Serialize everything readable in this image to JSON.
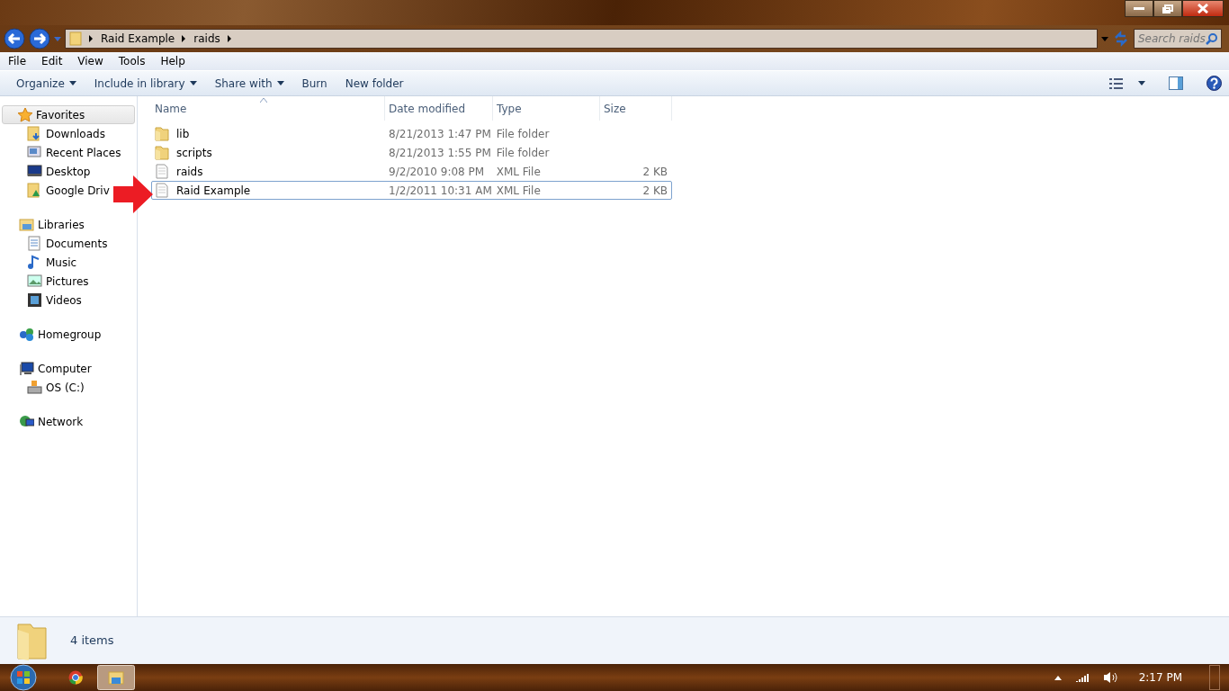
{
  "address_bar": {
    "crumbs": [
      "Raid Example",
      "raids"
    ]
  },
  "search": {
    "placeholder": "Search raids"
  },
  "menu": [
    "File",
    "Edit",
    "View",
    "Tools",
    "Help"
  ],
  "toolbar": [
    {
      "label": "Organize",
      "dropdown": true
    },
    {
      "label": "Include in library",
      "dropdown": true
    },
    {
      "label": "Share with",
      "dropdown": true
    },
    {
      "label": "Burn",
      "dropdown": false
    },
    {
      "label": "New folder",
      "dropdown": false
    }
  ],
  "sidebar": [
    {
      "label": "Favorites",
      "selected": true,
      "children": [
        {
          "label": "Downloads"
        },
        {
          "label": "Recent Places"
        },
        {
          "label": "Desktop"
        },
        {
          "label": "Google Driv"
        }
      ]
    },
    {
      "label": "Libraries",
      "selected": false,
      "children": [
        {
          "label": "Documents"
        },
        {
          "label": "Music"
        },
        {
          "label": "Pictures"
        },
        {
          "label": "Videos"
        }
      ]
    },
    {
      "label": "Homegroup",
      "selected": false
    },
    {
      "label": "Computer",
      "selected": false,
      "children": [
        {
          "label": "OS (C:)"
        }
      ]
    },
    {
      "label": "Network",
      "selected": false
    }
  ],
  "table": {
    "columns": [
      "Name",
      "Date modified",
      "Type",
      "Size"
    ],
    "rows": [
      {
        "kind": "folder",
        "name": "lib",
        "date": "8/21/2013 1:47 PM",
        "type": "File folder",
        "selected": false
      },
      {
        "kind": "folder",
        "name": "scripts",
        "date": "8/21/2013 1:55 PM",
        "type": "File folder",
        "selected": false
      },
      {
        "kind": "file",
        "name": "raids",
        "date": "9/2/2010 9:08 PM",
        "type": "XML File",
        "size": "2 KB",
        "selected": false
      },
      {
        "kind": "file",
        "name": "Raid Example",
        "date": "1/2/2011 10:31 AM",
        "type": "XML File",
        "size": "2 KB",
        "selected": true
      }
    ]
  },
  "status_bar": {
    "count": "4 items"
  },
  "taskbar": {
    "time": "2:17 PM"
  }
}
